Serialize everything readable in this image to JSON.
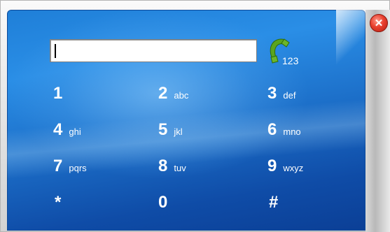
{
  "dialer": {
    "number_value": "",
    "call_label": "123",
    "close_icon": "close-icon",
    "call_icon": "phone-handset-icon"
  },
  "keypad": [
    {
      "digit": "1",
      "letters": ""
    },
    {
      "digit": "2",
      "letters": "abc"
    },
    {
      "digit": "3",
      "letters": "def"
    },
    {
      "digit": "4",
      "letters": "ghi"
    },
    {
      "digit": "5",
      "letters": "jkl"
    },
    {
      "digit": "6",
      "letters": "mno"
    },
    {
      "digit": "7",
      "letters": "pqrs"
    },
    {
      "digit": "8",
      "letters": "tuv"
    },
    {
      "digit": "9",
      "letters": "wxyz"
    },
    {
      "digit": "*",
      "letters": ""
    },
    {
      "digit": "0",
      "letters": ""
    },
    {
      "digit": "#",
      "letters": ""
    }
  ],
  "colors": {
    "panel_blue": "#1b6cc6",
    "call_green": "#5aa51e",
    "close_red": "#e8402e"
  }
}
